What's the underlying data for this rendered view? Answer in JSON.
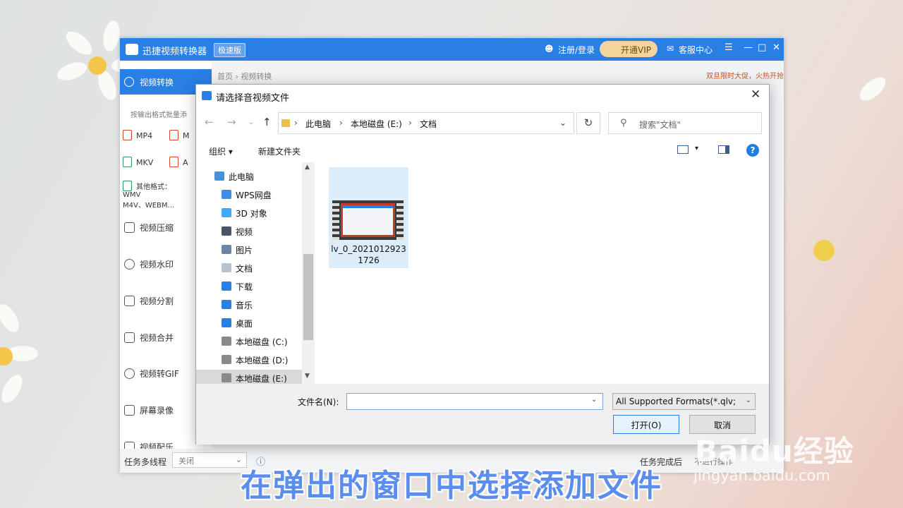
{
  "app": {
    "title": "迅捷视频转换器",
    "badge": "极速版",
    "login": "注册/登录",
    "vip": "开通VIP",
    "service": "客服中心",
    "nav_active": "视频转换",
    "batch_hint": "按输出格式批量添",
    "formats": [
      "MP4",
      "M",
      "MKV",
      "A"
    ],
    "other_formats": [
      "其他格式：WMV",
      "M4V、WEBM..."
    ],
    "side_items": [
      "视频压缩",
      "视频水印",
      "视频分割",
      "视频合并",
      "视频转GIF",
      "屏幕录像",
      "视频配乐"
    ],
    "breadcrumb": "首页 › 视频转换",
    "promo": "双旦限时大促，火热开抢",
    "footer": {
      "threads_label": "任务多线程",
      "threads_value": "关闭",
      "after_label": "任务完成后",
      "after_value": "不进行操作"
    }
  },
  "dialog": {
    "title": "请选择音视频文件",
    "address": {
      "crumbs": [
        "此电脑",
        "本地磁盘 (E:)",
        "文档"
      ]
    },
    "search_placeholder": "搜索\"文档\"",
    "toolbar": {
      "organize": "组织 ▾",
      "new_folder": "新建文件夹"
    },
    "tree": [
      {
        "label": "此电脑",
        "color": "#4a90d9"
      },
      {
        "label": "WPS网盘",
        "color": "#3c8ee8"
      },
      {
        "label": "3D 对象",
        "color": "#3fa9f5"
      },
      {
        "label": "视频",
        "color": "#46556a"
      },
      {
        "label": "图片",
        "color": "#6b86a6"
      },
      {
        "label": "文档",
        "color": "#b9c3cf"
      },
      {
        "label": "下载",
        "color": "#2a7fe4"
      },
      {
        "label": "音乐",
        "color": "#2a7fe4"
      },
      {
        "label": "桌面",
        "color": "#2a7fe4"
      },
      {
        "label": "本地磁盘 (C:)",
        "color": "#8a8a8a"
      },
      {
        "label": "本地磁盘 (D:)",
        "color": "#8a8a8a"
      },
      {
        "label": "本地磁盘 (E:)",
        "color": "#8a8a8a"
      }
    ],
    "file": {
      "name": "lv_0_20210129231726"
    },
    "filename_label": "文件名(N):",
    "filename_value": "",
    "filter": "All Supported Formats(*.qlv;",
    "open_button": "打开(O)",
    "cancel_button": "取消"
  },
  "overlay": {
    "caption": "在弹出的窗口中选择添加文件",
    "watermark": "Baidu经验",
    "watermark_url": "jingyan.baidu.com"
  }
}
